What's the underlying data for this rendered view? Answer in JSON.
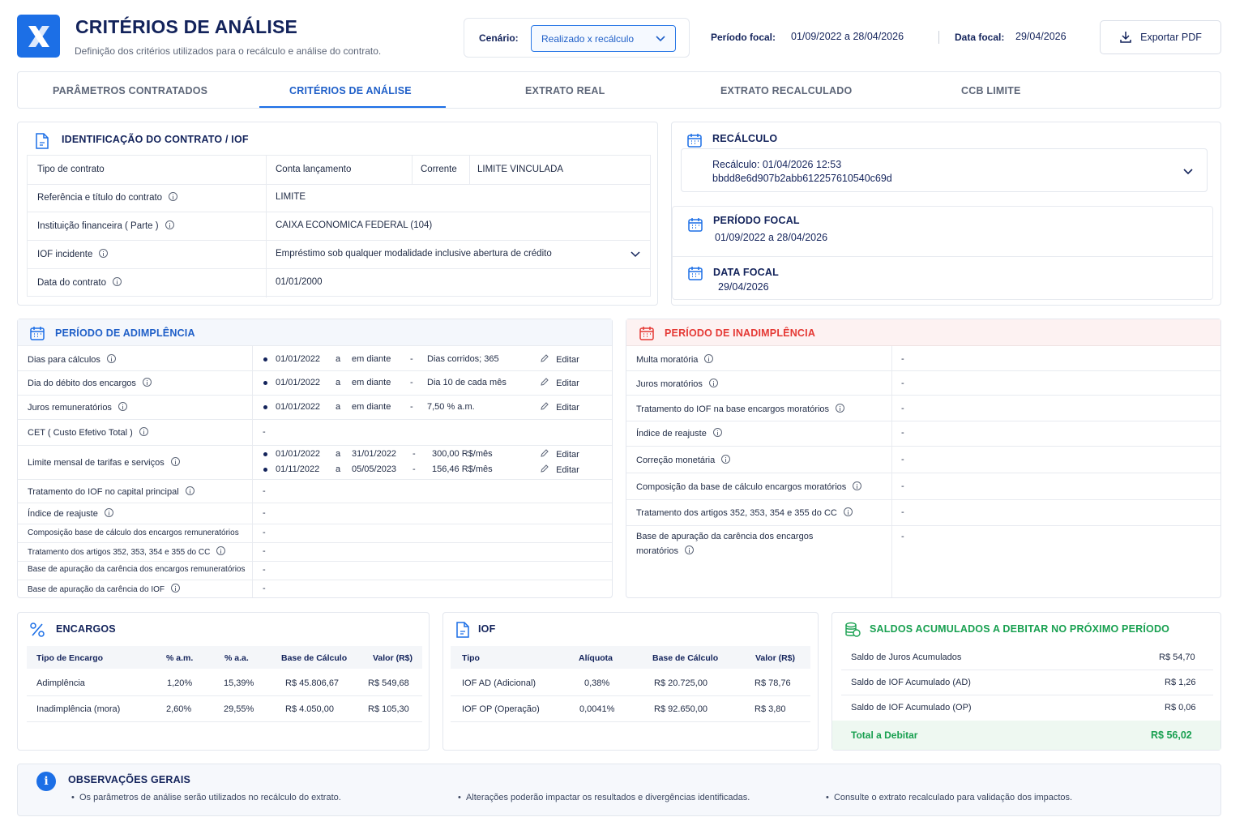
{
  "header": {
    "title": "CRITÉRIOS DE ANÁLISE",
    "subtitle": "Definição dos critérios utilizados para o recálculo e análise do contrato.",
    "scenario_label": "Cenário:",
    "scenario_value": "Realizado x recálculo",
    "focal_period_label": "Período focal:",
    "focal_period_value": "01/09/2022 a 28/04/2026",
    "focal_date_label": "Data focal:",
    "focal_date_value": "29/04/2026",
    "export_label": "Exportar PDF"
  },
  "tabs": [
    {
      "label": "PARÂMETROS CONTRATADOS"
    },
    {
      "label": "CRITÉRIOS DE ANÁLISE"
    },
    {
      "label": "EXTRATO REAL"
    },
    {
      "label": "EXTRATO RECALCULADO"
    },
    {
      "label": "CCB LIMITE"
    }
  ],
  "contract": {
    "title": "IDENTIFICAÇÃO DO CONTRATO / IOF",
    "rows": [
      {
        "label": "Tipo de contrato",
        "value": "Conta lançamento",
        "extra_label": "Corrente",
        "extra_value": "LIMITE VINCULADA"
      },
      {
        "label": "Referência e título do contrato",
        "value": "LIMITE"
      },
      {
        "label": "Instituição financeira ( Parte )",
        "value": "CAIXA ECONOMICA FEDERAL (104)"
      },
      {
        "label": "IOF incidente",
        "value": "Empréstimo sob qualquer modalidade inclusive abertura de crédito"
      },
      {
        "label": "Data do contrato",
        "value": "01/01/2000"
      }
    ]
  },
  "recalc": {
    "title": "RECÁLCULO",
    "line1": "Recálculo: 01/04/2026 12:53",
    "line2": "bbdd8e6d907b2abb612257610540c69d",
    "period_title": "PERÍODO FOCAL",
    "period_value": "01/09/2022 a 28/04/2026",
    "date_title": "DATA FOCAL",
    "date_value": "29/04/2026"
  },
  "adimplencia": {
    "title": "PERÍODO DE ADIMPLÊNCIA",
    "rows": [
      {
        "label": "Dias para cálculos",
        "entries": [
          {
            "from": "01/01/2022",
            "sep": "a",
            "to": "em diante",
            "dash": "-",
            "value": "Dias corridos; 365",
            "edit": "Editar"
          }
        ]
      },
      {
        "label": "Dia do débito dos encargos",
        "entries": [
          {
            "from": "01/01/2022",
            "sep": "a",
            "to": "em diante",
            "dash": "-",
            "value": "Dia 10 de cada mês",
            "edit": "Editar"
          }
        ]
      },
      {
        "label": "Juros remuneratórios",
        "entries": [
          {
            "from": "01/01/2022",
            "sep": "a",
            "to": "em diante",
            "dash": "-",
            "value": "7,50 % a.m.",
            "edit": "Editar"
          }
        ]
      },
      {
        "label": "CET ( Custo Efetivo Total )",
        "value": "-"
      },
      {
        "label": "Limite mensal de tarifas e serviços",
        "entries": [
          {
            "from": "01/01/2022",
            "sep": "a",
            "to": "31/01/2022",
            "dash": "-",
            "value": "300,00 R$/mês",
            "edit": "Editar"
          },
          {
            "from": "01/11/2022",
            "sep": "a",
            "to": "05/05/2023",
            "dash": "-",
            "value": "156,46 R$/mês",
            "edit": "Editar"
          }
        ]
      },
      {
        "label": "Tratamento do IOF no capital principal",
        "value": "-"
      },
      {
        "label": "Índice de reajuste",
        "value": "-"
      },
      {
        "label": "Composição base de cálculo dos encargos remuneratórios",
        "value": "-"
      },
      {
        "label": "Tratamento dos artigos 352, 353, 354 e 355 do CC",
        "value": "-"
      },
      {
        "label": "Base de apuração da carência dos encargos remuneratórios",
        "value": "-"
      },
      {
        "label": "Base de apuração da carência do IOF",
        "value": "-"
      }
    ]
  },
  "inadimplencia": {
    "title": "PERÍODO DE INADIMPLÊNCIA",
    "rows": [
      {
        "label": "Multa moratória",
        "value": "-"
      },
      {
        "label": "Juros moratórios",
        "value": "-"
      },
      {
        "label": "Tratamento do IOF na base encargos moratórios",
        "value": "-"
      },
      {
        "label": "Índice de reajuste",
        "value": "-"
      },
      {
        "label": "Correção monetária",
        "value": "-"
      },
      {
        "label": "Composição da base de cálculo encargos moratórios",
        "value": "-"
      },
      {
        "label": "Tratamento dos artigos 352, 353, 354 e 355 do CC",
        "value": "-"
      },
      {
        "label": "Base de apuração da carência dos encargos",
        "label2": "moratórios",
        "value": "-"
      }
    ]
  },
  "encargos": {
    "title": "ENCARGOS",
    "headers": [
      "Tipo de Encargo",
      "% a.m.",
      "% a.a.",
      "Base de Cálculo",
      "Valor (R$)"
    ],
    "rows": [
      [
        "Adimplência",
        "1,20%",
        "15,39%",
        "R$ 45.806,67",
        "R$ 549,68"
      ],
      [
        "Inadimplência (mora)",
        "2,60%",
        "29,55%",
        "R$ 4.050,00",
        "R$ 105,30"
      ]
    ]
  },
  "iof": {
    "title": "IOF",
    "headers": [
      "Tipo",
      "Alíquota",
      "Base de Cálculo",
      "Valor (R$)"
    ],
    "rows": [
      [
        "IOF AD (Adicional)",
        "0,38%",
        "R$ 20.725,00",
        "R$ 78,76"
      ],
      [
        "IOF OP (Operação)",
        "0,0041%",
        "R$ 92.650,00",
        "R$ 3,80"
      ]
    ]
  },
  "saldos": {
    "title": "SALDOS ACUMULADOS A DEBITAR NO PRÓXIMO PERÍODO",
    "rows": [
      {
        "label": "Saldo de Juros Acumulados",
        "value": "R$ 54,70"
      },
      {
        "label": "Saldo de IOF Acumulado (AD)",
        "value": "R$ 1,26"
      },
      {
        "label": "Saldo de IOF Acumulado (OP)",
        "value": "R$ 0,06"
      }
    ],
    "total_label": "Total a Debitar",
    "total_value": "R$ 56,02"
  },
  "obs": {
    "title": "OBSERVAÇÕES GERAIS",
    "items": [
      "Os parâmetros de análise serão utilizados no recálculo do extrato.",
      "Alterações poderão impactar os resultados e divergências identificadas.",
      "Consulte o extrato recalculado para validação dos impactos."
    ]
  },
  "colors": {
    "accent": "#1c6fe6",
    "navy": "#13235b",
    "green": "#18a050",
    "red": "#e53935"
  }
}
